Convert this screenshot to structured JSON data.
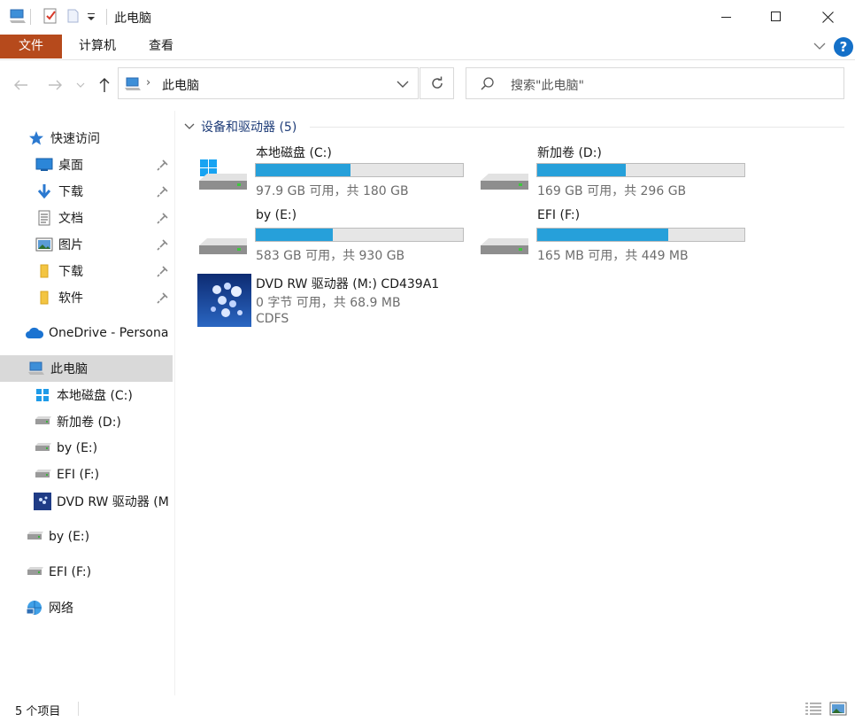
{
  "window": {
    "title": "此电脑"
  },
  "ribbon": {
    "tabs": [
      "文件",
      "计算机",
      "查看"
    ]
  },
  "address": {
    "path": "此电脑",
    "search_placeholder": "搜索\"此电脑\""
  },
  "nav": {
    "quick_access": "快速访问",
    "quick_items": [
      "桌面",
      "下载",
      "文档",
      "图片",
      "下载",
      "软件"
    ],
    "onedrive": "OneDrive - Persona",
    "this_pc": "此电脑",
    "pc_children": [
      "本地磁盘 (C:)",
      "新加卷 (D:)",
      "by (E:)",
      "EFI (F:)",
      "DVD RW 驱动器 (M"
    ],
    "extra": [
      "by (E:)",
      "EFI (F:)"
    ],
    "network": "网络"
  },
  "content": {
    "group_header": "设备和驱动器 (5)",
    "drives": [
      {
        "name": "本地磁盘 (C:)",
        "space": "97.9 GB 可用，共 180 GB",
        "used_fraction": 0.456
      },
      {
        "name": "新加卷 (D:)",
        "space": "169 GB 可用，共 296 GB",
        "used_fraction": 0.429
      },
      {
        "name": "by (E:)",
        "space": "583 GB 可用，共 930 GB",
        "used_fraction": 0.373
      },
      {
        "name": "EFI (F:)",
        "space": "165 MB 可用，共 449 MB",
        "used_fraction": 0.633
      }
    ],
    "dvd": {
      "name": "DVD RW 驱动器 (M:) CD439A1",
      "space": "0 字节 可用，共 68.9 MB",
      "fs": "CDFS"
    }
  },
  "status": {
    "count": "5 个项目"
  },
  "colors": {
    "file_tab": "#b64a1c",
    "usage_bar": "#26a0da",
    "selection": "#d9d9d9",
    "header_blue": "#1e3c78"
  }
}
